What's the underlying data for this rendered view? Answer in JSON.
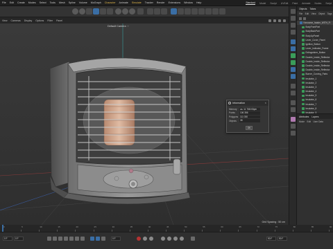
{
  "menubar": {
    "items": [
      "File",
      "Edit",
      "Create",
      "Modes",
      "Select",
      "Tools",
      "Mesh",
      "Spline",
      "Volume",
      "MoGraph",
      "Character",
      "Animate",
      "Simulate",
      "Tracker",
      "Render",
      "Extensions",
      "Window",
      "Help"
    ],
    "highlighted": [
      "Character",
      "Simulate"
    ],
    "layouts": [
      "Standard",
      "Model",
      "Sculpt",
      "UVEdit",
      "Paint",
      "Animate",
      "Nodes",
      "Script"
    ],
    "active_layout": "Standard"
  },
  "viewport": {
    "menu": [
      "View",
      "Cameras",
      "Display",
      "Options",
      "Filter",
      "Panel"
    ],
    "camera_label": "Default Camera ·:·",
    "grid_spacing": "Grid Spacing : 50 cm"
  },
  "info_dialog": {
    "title": "Information",
    "rows": [
      {
        "label": "Memory",
        "value": "ca. 11 758 KByte"
      },
      {
        "label": "Points",
        "value": "106 356"
      },
      {
        "label": "Polygons",
        "value": "111 030"
      },
      {
        "label": "Objects",
        "value": "38"
      }
    ],
    "ok_label": "OK"
  },
  "objects_panel": {
    "tabs": [
      "Objects",
      "Takes"
    ],
    "menu": [
      "File",
      "Edit",
      "View",
      "Object",
      "Tags",
      "Bookmarks"
    ],
    "items": [
      "Kerosene_heater_WITH_Fi",
      "BodyFrontPart",
      "BodyBackPart",
      "BodyUpPanel",
      "Lever_Cover_Panel",
      "Ignition_Button",
      "Lever_Indicator_Frame",
      "Extinguisher_Button",
      "Double_Inside_Reflector",
      "Double_Inside_Reflector",
      "Double_Inside_Reflector",
      "Double_Inside_Reflector",
      "Burner_Curving_Parts",
      "Insulator_1",
      "Insulator_2",
      "Insulator_3",
      "Insulator_4",
      "Insulator_5",
      "Insulator_6",
      "Insulator_7",
      "Insulator_8",
      "Insulator_9"
    ]
  },
  "attributes_panel": {
    "tabs": [
      "Attributes",
      "Layers"
    ],
    "menu": [
      "Mode",
      "Edit",
      "User Data"
    ]
  },
  "timeline": {
    "ticks": [
      "0",
      "5",
      "10",
      "15",
      "20",
      "25",
      "30",
      "35",
      "40",
      "45",
      "50",
      "55",
      "60",
      "65",
      "70",
      "75",
      "80",
      "85",
      "90"
    ],
    "current_frame": "0 F",
    "start_field": "0 F",
    "end_field": "90 F",
    "min_field": "90 F",
    "fps_field": "0 F"
  },
  "colors": {
    "accent": "#3a6ea5",
    "highlight": "#e0b64a",
    "object_icon": "#3a9d5a",
    "record": "#b53232"
  }
}
